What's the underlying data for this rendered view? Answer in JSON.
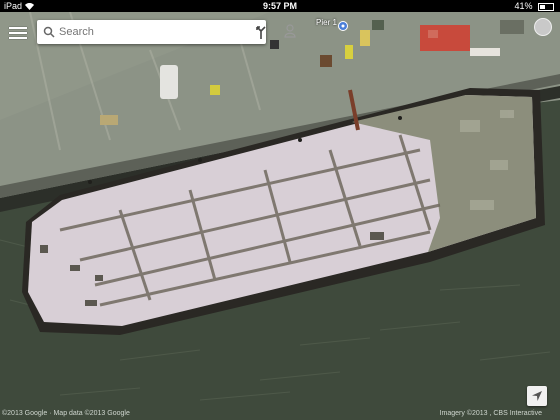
{
  "statusbar": {
    "device": "iPad",
    "time": "9:57 PM",
    "battery": "41%"
  },
  "search": {
    "placeholder": "Search"
  },
  "map": {
    "place_label": "Pier 1"
  },
  "footer": {
    "attribution": "©2013 Google · Map data ©2013 Google",
    "imagery": "Imagery ©2013 , CBS Interactive"
  },
  "icons": {
    "menu": "menu-icon",
    "search": "search-icon",
    "directions": "directions-icon",
    "account": "person-icon",
    "location": "my-location-icon",
    "wifi": "wifi-icon"
  },
  "colors": {
    "water": "#3f4a3c",
    "pier": "#8e9688",
    "deck": "#d8cfd6",
    "barge_edge": "#2d2a25"
  }
}
